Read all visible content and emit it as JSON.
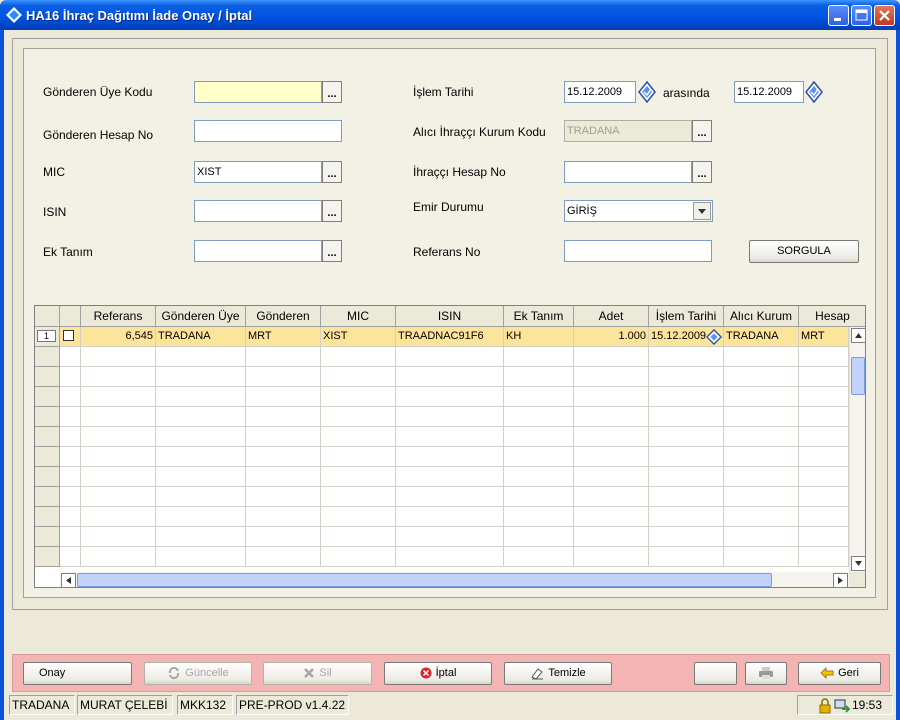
{
  "window": {
    "title": "HA16 İhraç Dağıtımı İade Onay / İptal"
  },
  "form": {
    "gonderen_uye_kodu": {
      "label": "Gönderen Üye Kodu",
      "value": ""
    },
    "gonderen_hesap_no": {
      "label": "Gönderen Hesap No",
      "value": ""
    },
    "mic": {
      "label": "MIC",
      "value": "XIST"
    },
    "isin": {
      "label": "ISIN",
      "value": ""
    },
    "ek_tanim": {
      "label": "Ek Tanım",
      "value": ""
    },
    "islem_tarihi": {
      "label": "İşlem Tarihi",
      "from": "15.12.2009",
      "between": "arasında",
      "to": "15.12.2009"
    },
    "alici_ihracci_kurum_kodu": {
      "label": "Alıcı İhraççı Kurum Kodu",
      "value": "TRADANA"
    },
    "ihracci_hesap_no": {
      "label": "İhraççı Hesap No",
      "value": ""
    },
    "emir_durumu": {
      "label": "Emir Durumu",
      "value": "GİRİŞ"
    },
    "referans_no": {
      "label": "Referans No",
      "value": ""
    },
    "ellipsis": "...",
    "sorgula": "SORGULA"
  },
  "grid": {
    "columns": [
      "Referans",
      "Gönderen Üye",
      "Gönderen",
      "MIC",
      "ISIN",
      "Ek Tanım",
      "Adet",
      "İşlem Tarihi",
      "Alıcı Kurum",
      "Hesap"
    ],
    "rows": [
      {
        "num": "1",
        "referans": "6,545",
        "gonderen_uye": "TRADANA",
        "gonderen": "MRT",
        "mic": "XIST",
        "isin": "TRAADNAC91F6",
        "ek_tanim": "KH",
        "adet": "1.000",
        "islem_tarihi": "15.12.2009",
        "alici_kurum": "TRADANA",
        "hesap": "MRT"
      }
    ]
  },
  "toolbar": {
    "onay": "Onay",
    "guncelle": "Güncelle",
    "sil": "Sil",
    "iptal": "İptal",
    "temizle": "Temizle",
    "geri": "Geri"
  },
  "status": {
    "user_code": "TRADANA",
    "user_name": "MURAT ÇELEBİ",
    "terminal": "MKK132",
    "environment": "PRE-PROD v1.4.22",
    "time": "19:53"
  },
  "colors": {
    "titlebar": "#0055e5",
    "toolbar": "#f3b4b4",
    "selected_row": "#fde49b",
    "required_field": "#ffffc8"
  }
}
